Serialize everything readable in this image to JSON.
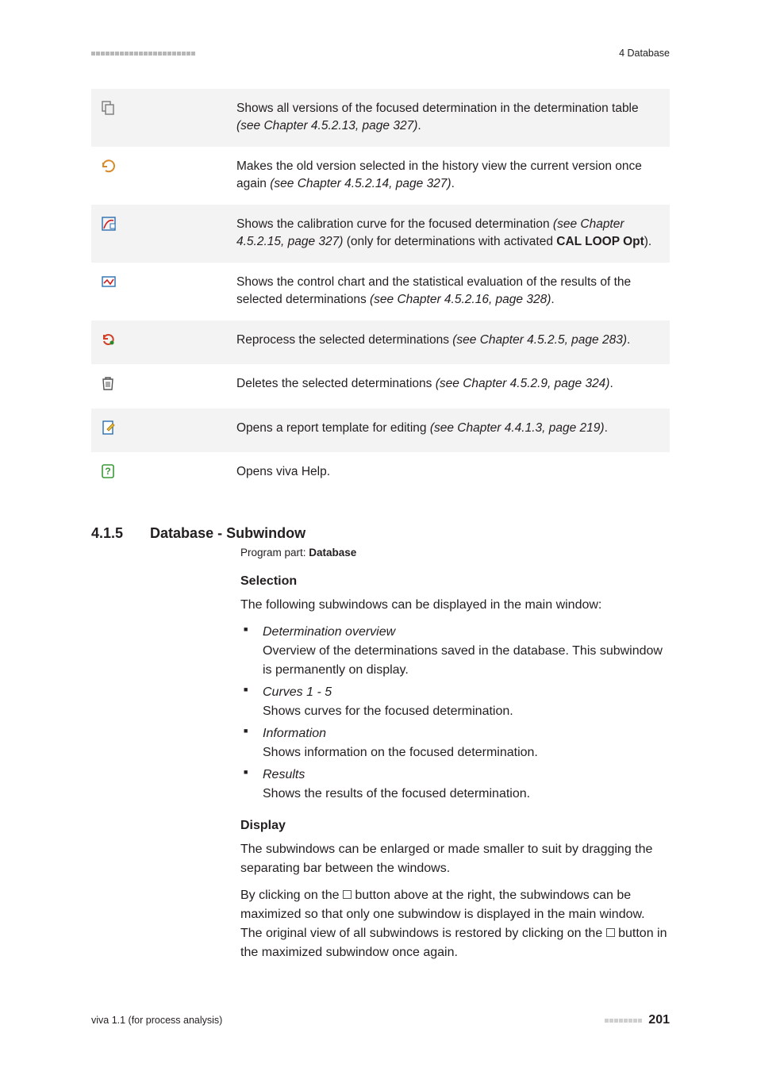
{
  "header": {
    "right": "4 Database"
  },
  "icons": [
    {
      "name": "versions-icon",
      "svg": "<svg width='20' height='20' viewBox='0 0 20 20'><rect x='2' y='2' width='10' height='12' fill='none' stroke='#7a7a7a' stroke-width='1.4'/><rect x='6' y='6' width='10' height='12' fill='#eee' stroke='#7a7a7a' stroke-width='1.4'/></svg>",
      "text_pre": "Shows all versions of the focused determination in the determination table ",
      "ref": "(see Chapter 4.5.2.13, page 327)",
      "text_post": "."
    },
    {
      "name": "restore-version-icon",
      "svg": "<svg width='20' height='20' viewBox='0 0 20 20'><path d='M3 10 A7 7 0 1 1 6 16' fill='none' stroke='#d98a2a' stroke-width='2'/><path d='M3 6 L3 11 L8 11' fill='none' stroke='#d98a2a' stroke-width='2'/></svg>",
      "text_pre": "Makes the old version selected in the history view the current version once again ",
      "ref": "(see Chapter 4.5.2.14, page 327)",
      "text_post": "."
    },
    {
      "name": "calibration-curve-icon",
      "svg": "<svg width='20' height='20' viewBox='0 0 20 20'><rect x='2' y='2' width='16' height='16' fill='none' stroke='#2a6fb0' stroke-width='1.4'/><path d='M4 16 Q8 4 16 6' fill='none' stroke='#d02020' stroke-width='1.6'/><rect x='12' y='10' width='6' height='6' fill='#fff' stroke='#2a6fb0'/></svg>",
      "text_pre": "Shows the calibration curve for the focused determination ",
      "ref": "(see Chapter 4.5.2.15, page 327)",
      "text_post_html": " (only for determinations with activated <b>CAL LOOP Opt</b>)."
    },
    {
      "name": "control-chart-icon",
      "svg": "<svg width='20' height='20' viewBox='0 0 20 20'><rect x='2' y='4' width='16' height='12' fill='#fff' stroke='#2a6fb0' stroke-width='1.4'/><path d='M4 12 L8 8 L12 13 L16 7' fill='none' stroke='#d02020' stroke-width='1.6'/></svg>",
      "text_pre": "Shows the control chart and the statistical evaluation of the results of the selected determinations ",
      "ref": "(see Chapter 4.5.2.16, page 328)",
      "text_post": "."
    },
    {
      "name": "reprocess-icon",
      "svg": "<svg width='20' height='20' viewBox='0 0 20 20'><path d='M4 8 A6 6 0 1 1 4 12' fill='none' stroke='#d04028' stroke-width='2'/><path d='M4 4 L4 9 L9 9' fill='none' stroke='#d04028' stroke-width='2'/><circle cx='14' cy='14' r='2.5' fill='#2a8a2a'/></svg>",
      "text_pre": "Reprocess the selected determinations ",
      "ref": "(see Chapter 4.5.2.5, page 283)",
      "text_post": "."
    },
    {
      "name": "delete-icon",
      "svg": "<svg width='18' height='20' viewBox='0 0 18 20'><path d='M3 5 L15 5 L14 18 L4 18 Z' fill='none' stroke='#555' stroke-width='1.4'/><path d='M6 5 L6 3 L12 3 L12 5' fill='none' stroke='#555' stroke-width='1.4'/><line x1='7' y1='8' x2='7' y2='15' stroke='#555'/><line x1='9' y1='8' x2='9' y2='15' stroke='#555'/><line x1='11' y1='8' x2='11' y2='15' stroke='#555'/></svg>",
      "text_pre": "Deletes the selected determinations ",
      "ref": "(see Chapter 4.5.2.9, page 324)",
      "text_post": "."
    },
    {
      "name": "edit-template-icon",
      "svg": "<svg width='20' height='20' viewBox='0 0 20 20'><rect x='3' y='2' width='12' height='16' fill='#fff' stroke='#2a6fb0' stroke-width='1.4'/><path d='M10 14 L17 7 L15 5 L8 12 Z' fill='#e8c040' stroke='#a07000' stroke-width='0.8'/></svg>",
      "text_pre": "Opens a report template for editing ",
      "ref": "(see Chapter 4.4.1.3, page 219)",
      "text_post": "."
    },
    {
      "name": "help-icon",
      "svg": "<svg width='20' height='20' viewBox='0 0 20 20'><rect x='2' y='2' width='14' height='16' rx='2' fill='#fff' stroke='#3a9a3a' stroke-width='1.6'/><text x='9' y='14' font-size='12' font-weight='bold' fill='#3a9a3a' text-anchor='middle'>?</text></svg>",
      "text_pre": "Opens viva Help.",
      "ref": "",
      "text_post": ""
    }
  ],
  "section": {
    "number": "4.1.5",
    "title": "Database - Subwindow",
    "program_part_label": "Program part: ",
    "program_part_value": "Database",
    "sub1": {
      "heading": "Selection",
      "intro": "The following subwindows can be displayed in the main window:",
      "items": [
        {
          "title": "Determination overview",
          "desc": "Overview of the determinations saved in the database. This subwindow is permanently on display."
        },
        {
          "title": "Curves 1 - 5",
          "desc": "Shows curves for the focused determination."
        },
        {
          "title": "Information",
          "desc": "Shows information on the focused determination."
        },
        {
          "title": "Results",
          "desc": "Shows the results of the focused determination."
        }
      ]
    },
    "sub2": {
      "heading": "Display",
      "p1": "The subwindows can be enlarged or made smaller to suit by dragging the separating bar between the windows.",
      "p2a": "By clicking on the ",
      "p2b": " button above at the right, the subwindows can be maximized so that only one subwindow is displayed in the main window. The original view of all subwindows is restored by clicking on the ",
      "p2c": " button in the maximized subwindow once again."
    }
  },
  "footer": {
    "left": "viva 1.1 (for process analysis)",
    "page": "201"
  }
}
